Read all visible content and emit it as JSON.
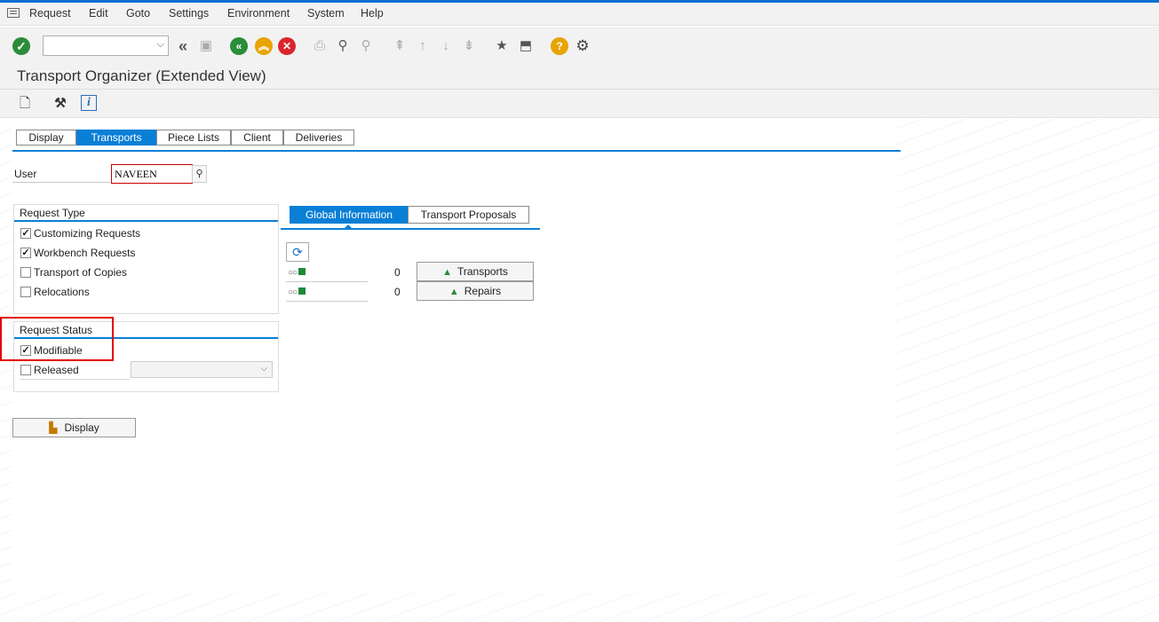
{
  "menu": {
    "items": [
      "Request",
      "Edit",
      "Goto",
      "Settings",
      "Environment",
      "System",
      "Help"
    ]
  },
  "toolbar": {
    "command_field_value": "",
    "icons": [
      "enter-icon",
      "back-double-icon",
      "save-icon",
      "back-icon",
      "exit-icon",
      "cancel-icon",
      "print-icon",
      "find-icon",
      "find-next-icon",
      "first-page-icon",
      "previous-page-icon",
      "next-page-icon",
      "last-page-icon",
      "new-session-icon",
      "shortcut-icon",
      "help-icon",
      "settings-icon"
    ]
  },
  "page": {
    "title": "Transport Organizer (Extended View)"
  },
  "tabs": {
    "main": [
      "Display",
      "Transports",
      "Piece Lists",
      "Client",
      "Deliveries"
    ],
    "active_main": "Transports",
    "right": [
      "Global Information",
      "Transport Proposals"
    ],
    "active_right": "Global Information"
  },
  "user": {
    "label": "User",
    "value": "NAVEEN"
  },
  "request_type": {
    "title": "Request Type",
    "items": [
      {
        "label": "Customizing Requests",
        "checked": true
      },
      {
        "label": "Workbench Requests",
        "checked": true
      },
      {
        "label": "Transport of Copies",
        "checked": false
      },
      {
        "label": "Relocations",
        "checked": false
      }
    ]
  },
  "request_status": {
    "title": "Request Status",
    "items": [
      {
        "label": "Modifiable",
        "checked": true
      },
      {
        "label": "Released",
        "checked": false
      }
    ],
    "released_select_value": ""
  },
  "global_info": {
    "rows": [
      {
        "count": "0",
        "button_label": "Transports"
      },
      {
        "count": "0",
        "button_label": "Repairs"
      }
    ]
  },
  "buttons": {
    "display_label": "Display"
  },
  "colors": {
    "accent": "#0a7fd6",
    "highlight": "#e00000",
    "ok_green": "#2b8c3a"
  }
}
